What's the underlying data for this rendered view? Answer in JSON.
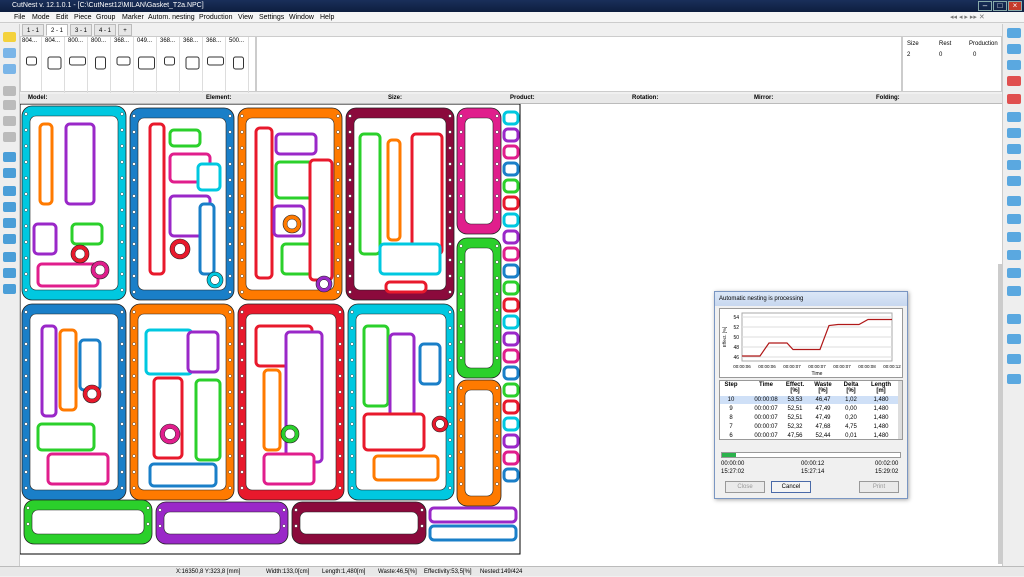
{
  "window": {
    "title": "CutNest v. 12.1.0.1 - [C:\\CutNest12\\MILAN\\Gasket_T2a.NPC]"
  },
  "menu": [
    "File",
    "Mode",
    "Edit",
    "Piece",
    "Group",
    "Marker",
    "Autom. nesting",
    "Production",
    "View",
    "Settings",
    "Window",
    "Help"
  ],
  "tabs": [
    "1 - 1",
    "2 - 1",
    "3 - 1",
    "4 - 1",
    "+"
  ],
  "parts": [
    "804...",
    "804...",
    "800...",
    "800...",
    "368...",
    "049...",
    "368...",
    "368...",
    "368...",
    "500..."
  ],
  "size_panel": {
    "headers": [
      "Size",
      "Rest",
      "Production"
    ],
    "row": [
      "2",
      "0",
      "0"
    ]
  },
  "header_columns": [
    "Model:",
    "Element:",
    "Size:",
    "Product:",
    "Rotation:",
    "Mirror:",
    "Folding:"
  ],
  "colors": {
    "cyan": "#00c8e0",
    "blue": "#1a7fc8",
    "orange": "#ff7a00",
    "red": "#e8192c",
    "maroon": "#8b0a3c",
    "green": "#2bd02b",
    "purple": "#9a28c8",
    "magenta": "#e01e8c"
  },
  "dialog": {
    "title": "Automatic nesting is processing",
    "graph": {
      "y_label": "Effect. [%]",
      "x_label": "Time",
      "y_ticks": [
        "54",
        "52",
        "50",
        "48",
        "46"
      ],
      "x_ticks": [
        "00:00:06",
        "00:00:06",
        "00:00:07",
        "00:00:07",
        "00:00:07",
        "00:00:08",
        "00:00:12"
      ]
    },
    "table": {
      "headers": [
        "Step",
        "Time",
        "Effect. [%]",
        "Waste [%]",
        "Delta [%]",
        "Length [m]"
      ],
      "rows": [
        [
          "10",
          "00:00:08",
          "53,53",
          "46,47",
          "1,02",
          "1,480"
        ],
        [
          "9",
          "00:00:07",
          "52,51",
          "47,49",
          "0,00",
          "1,480"
        ],
        [
          "8",
          "00:00:07",
          "52,51",
          "47,49",
          "0,20",
          "1,480"
        ],
        [
          "7",
          "00:00:07",
          "52,32",
          "47,68",
          "4,75",
          "1,480"
        ],
        [
          "6",
          "00:00:07",
          "47,56",
          "52,44",
          "0,01",
          "1,480"
        ]
      ]
    },
    "progress_fraction": 0.08,
    "times": {
      "start": "00:00:00",
      "elapsed": "00:00:12",
      "limit": "00:02:00",
      "clock_start": "15:27:02",
      "clock_now": "15:27:14",
      "clock_end": "15:29:02"
    },
    "buttons": {
      "close": "Close",
      "cancel": "Cancel",
      "print": "Print"
    }
  },
  "status": {
    "coords": "X:16350,8  Y:323,8 [mm]",
    "width": "Width:133,0[cm]",
    "length": "Length:1,480[m]",
    "waste": "Waste:46,5[%]",
    "effectivity": "Effectivity:53,5[%]",
    "nested": "Nested:149/424"
  }
}
